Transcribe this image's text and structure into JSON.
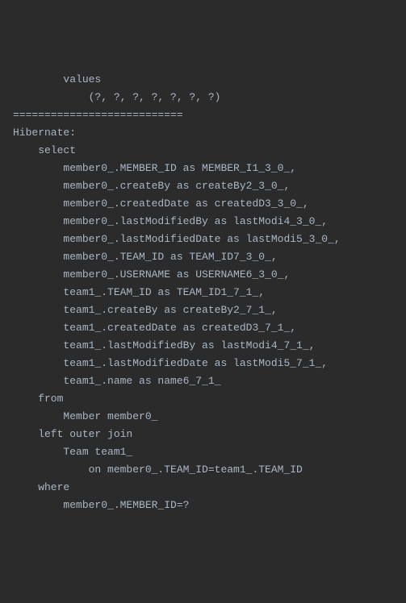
{
  "code": {
    "lines": [
      "        values",
      "            (?, ?, ?, ?, ?, ?, ?)",
      "===========================",
      "Hibernate: ",
      "    select",
      "        member0_.MEMBER_ID as MEMBER_I1_3_0_,",
      "        member0_.createBy as createBy2_3_0_,",
      "        member0_.createdDate as createdD3_3_0_,",
      "        member0_.lastModifiedBy as lastModi4_3_0_,",
      "        member0_.lastModifiedDate as lastModi5_3_0_,",
      "        member0_.TEAM_ID as TEAM_ID7_3_0_,",
      "        member0_.USERNAME as USERNAME6_3_0_,",
      "        team1_.TEAM_ID as TEAM_ID1_7_1_,",
      "        team1_.createBy as createBy2_7_1_,",
      "        team1_.createdDate as createdD3_7_1_,",
      "        team1_.lastModifiedBy as lastModi4_7_1_,",
      "        team1_.lastModifiedDate as lastModi5_7_1_,",
      "        team1_.name as name6_7_1_ ",
      "    from",
      "        Member member0_ ",
      "    left outer join",
      "        Team team1_ ",
      "            on member0_.TEAM_ID=team1_.TEAM_ID ",
      "    where",
      "        member0_.MEMBER_ID=?"
    ]
  }
}
